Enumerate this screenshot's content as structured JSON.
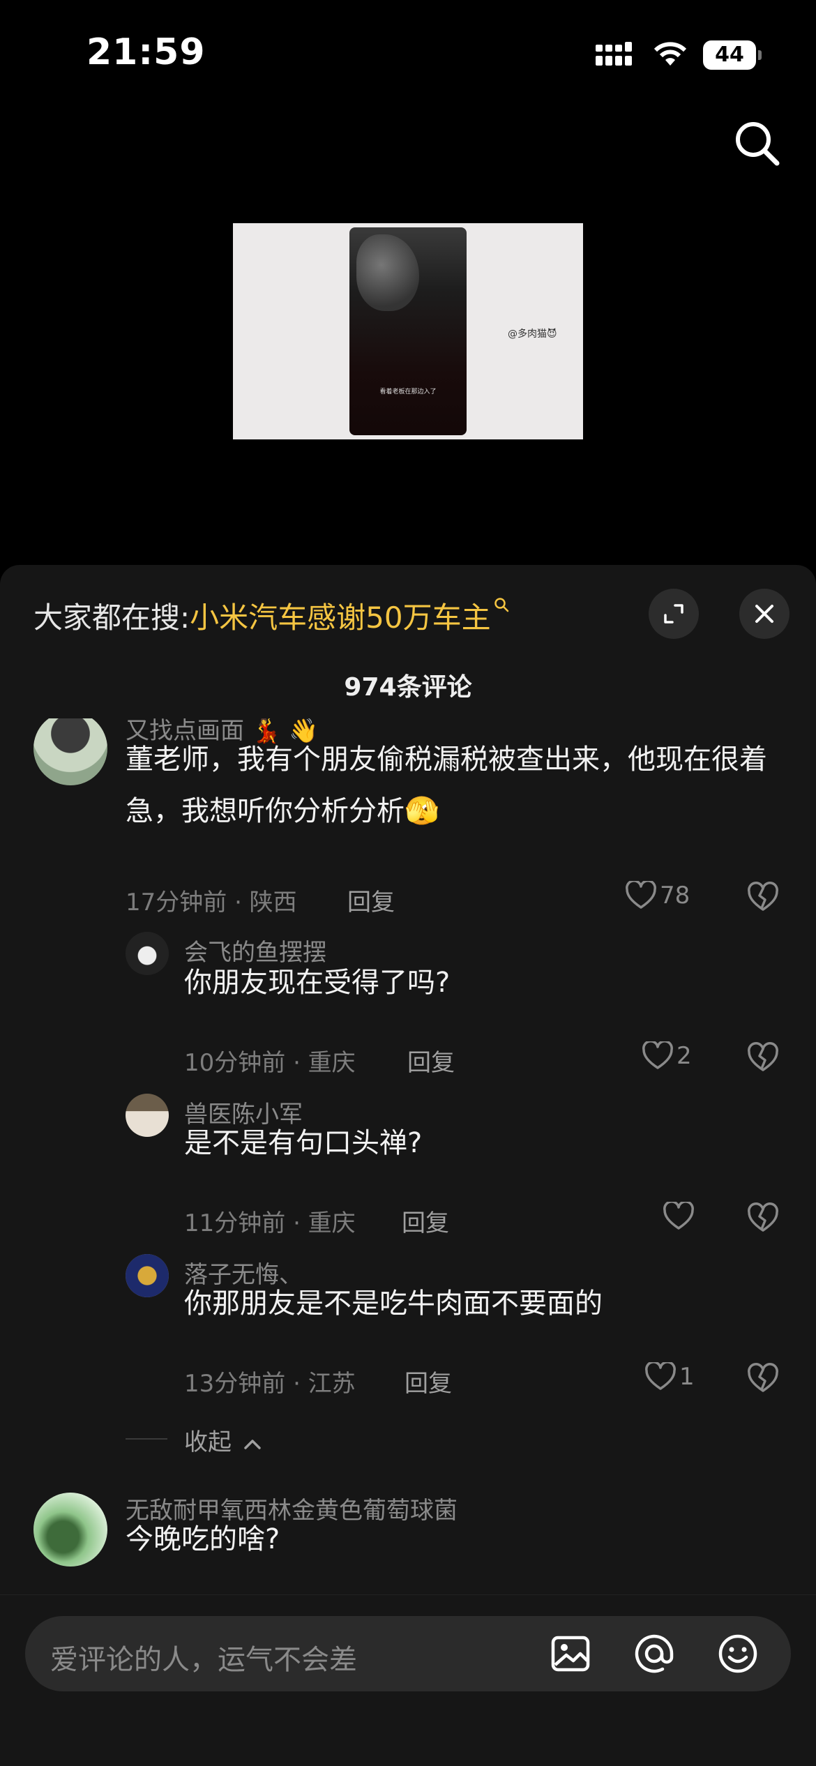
{
  "status_bar": {
    "time": "21:59",
    "battery": "44"
  },
  "video": {
    "caption": "看着老板在那边入了",
    "handle": "@多肉猫😈"
  },
  "header": {
    "hot_search_prefix": "大家都在搜:",
    "hot_search_keyword": "小米汽车感谢50万车主",
    "comment_count": "974条评论"
  },
  "comments": [
    {
      "name": "又找点画面 💃 👋",
      "text": "董老师，我有个朋友偷税漏税被查出来，他现在很着急，我想听你分析分析🫣",
      "meta": "17分钟前 · 陕西",
      "reply": "回复",
      "likes": "78",
      "replies": [
        {
          "name": "会飞的鱼摆摆",
          "text": "你朋友现在受得了吗?",
          "meta": "10分钟前 · 重庆",
          "reply": "回复",
          "likes": "2"
        },
        {
          "name": "兽医陈小军",
          "text": "是不是有句口头禅?",
          "meta": "11分钟前 · 重庆",
          "reply": "回复",
          "likes": ""
        },
        {
          "name": "落子无悔、",
          "text": "你那朋友是不是吃牛肉面不要面的",
          "meta": "13分钟前 · 江苏",
          "reply": "回复",
          "likes": "1"
        }
      ],
      "collapse": "收起"
    },
    {
      "name": "无敌耐甲氧西林金黄色葡萄球菌",
      "text": "今晚吃的啥?"
    }
  ],
  "input": {
    "placeholder": "爱评论的人，运气不会差"
  },
  "icons": [
    "signal-icon",
    "wifi-icon",
    "battery-icon",
    "search-icon",
    "expand-icon",
    "close-icon",
    "heart-icon",
    "broken-heart-icon",
    "image-icon",
    "at-icon",
    "emoji-icon"
  ],
  "colors": {
    "accent": "#f5c542",
    "sheet_bg": "#161616"
  }
}
